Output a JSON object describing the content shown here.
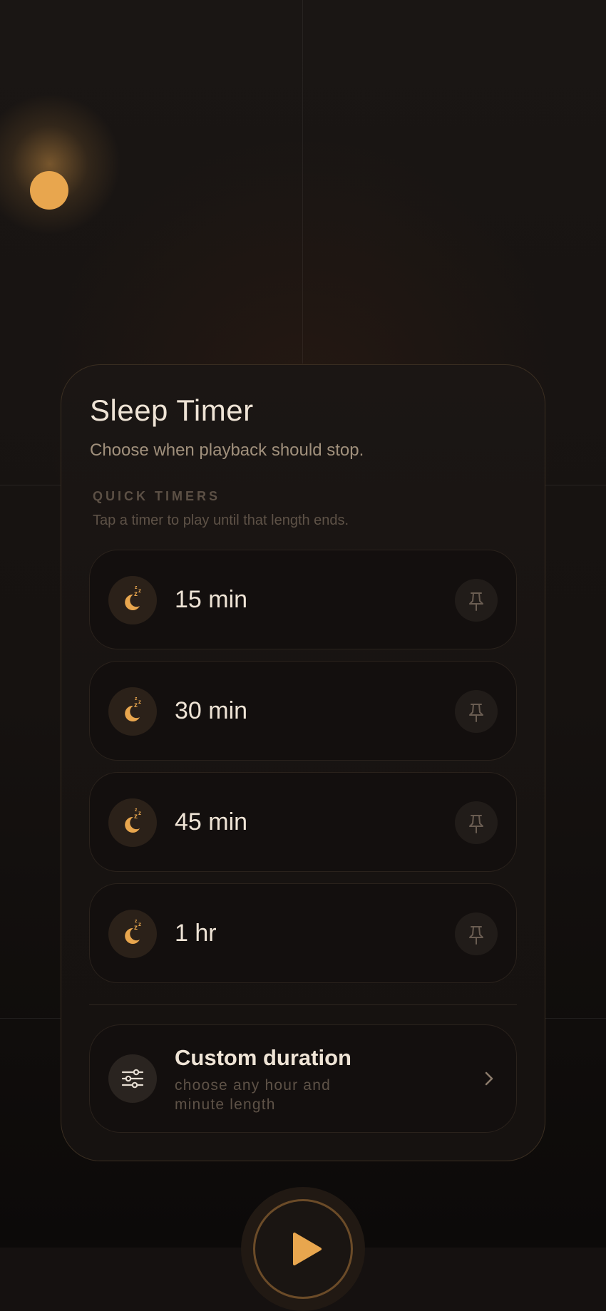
{
  "sheet": {
    "title": "Sleep Timer",
    "subtitle": "Choose when playback should stop.",
    "section_label": "QUICK TIMERS",
    "section_hint": "Tap a timer to play until that length ends."
  },
  "timers": [
    {
      "label": "15 min",
      "icon": "sleep-moon-icon",
      "action_icon": "pin-icon"
    },
    {
      "label": "30 min",
      "icon": "sleep-moon-icon",
      "action_icon": "pin-icon"
    },
    {
      "label": "45 min",
      "icon": "sleep-moon-icon",
      "action_icon": "pin-icon"
    },
    {
      "label": "1 hr",
      "icon": "sleep-moon-icon",
      "action_icon": "pin-icon"
    }
  ],
  "custom": {
    "title": "Custom duration",
    "description": "choose any hour and minute length",
    "icon": "sliders-icon",
    "action_icon": "chevron-right-icon"
  },
  "player": {
    "play_icon": "play-icon"
  },
  "colors": {
    "accent": "#e8a64e",
    "background": "#151110",
    "card": "#1a1614",
    "text_primary": "#efe4d6",
    "text_secondary": "#a0907c",
    "text_muted": "#5e5247"
  }
}
